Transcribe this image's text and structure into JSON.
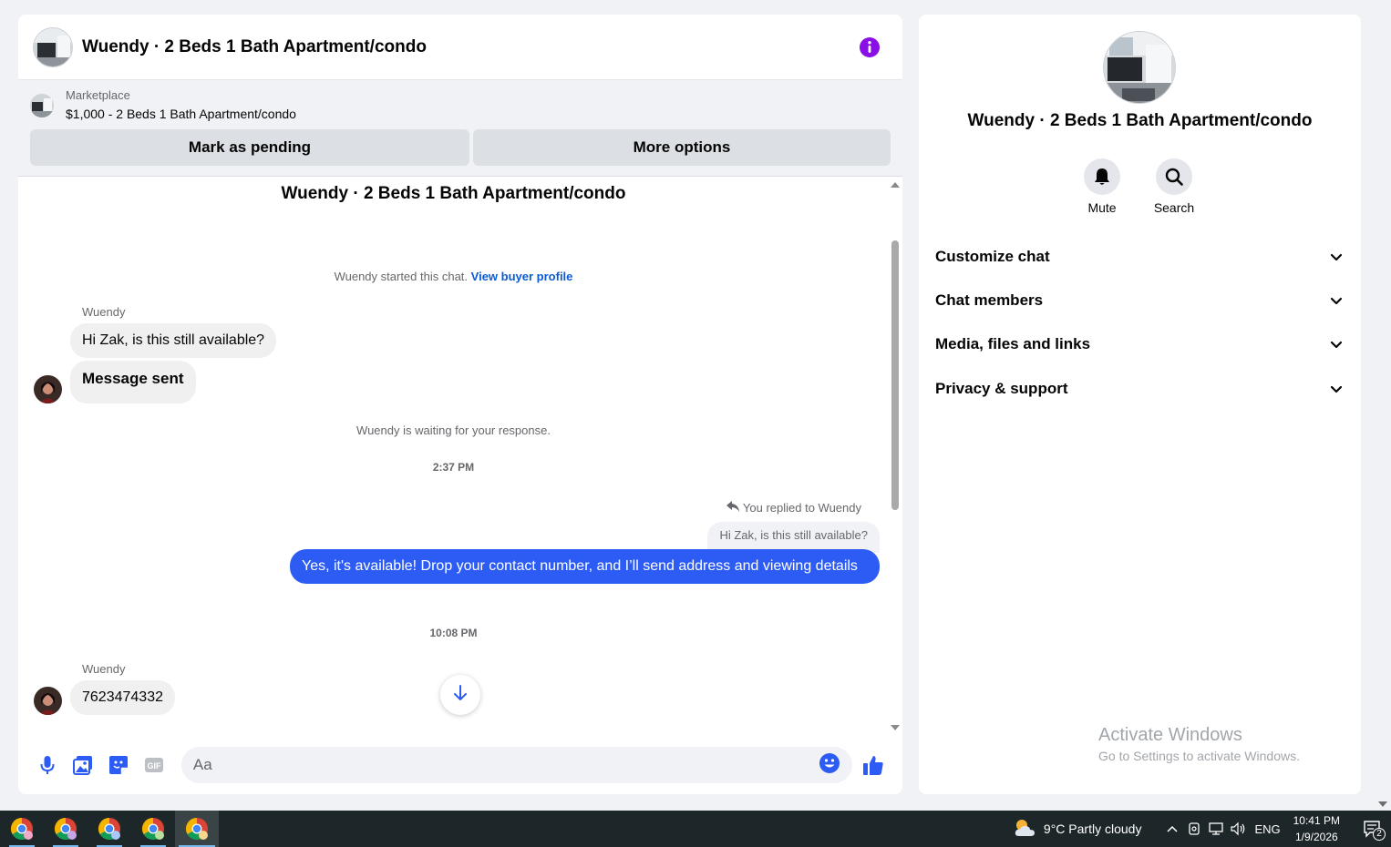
{
  "chat": {
    "title": "Wuendy · 2 Beds 1 Bath Apartment/condo",
    "marketplace_label": "Marketplace",
    "listing": "$1,000 - 2 Beds 1 Bath Apartment/condo",
    "mark_pending_label": "Mark as pending",
    "more_options_label": "More options",
    "conversation_title": "Wuendy · 2 Beds 1 Bath Apartment/condo",
    "started_text": "Wuendy started this chat.",
    "view_buyer_profile": "View buyer profile",
    "sender_1": "Wuendy",
    "msg_1": "Hi Zak, is this still available?",
    "msg_2": "Message sent",
    "waiting_text": "Wuendy is waiting for your response.",
    "time_1": "2:37 PM",
    "reply_note": "You replied to Wuendy",
    "quoted": "Hi Zak, is this still available?",
    "my_reply": "Yes, it's available! Drop your contact number, and I’ll send address and viewing details",
    "time_2": "10:08 PM",
    "sender_2": "Wuendy",
    "msg_3": "7623474332",
    "composer_placeholder": "Aa",
    "accent_color": "#2d5cf5",
    "info_color": "#8a0ee6"
  },
  "info": {
    "name": "Wuendy · 2 Beds 1 Bath Apartment/condo",
    "mute_label": "Mute",
    "search_label": "Search",
    "sections": [
      "Customize chat",
      "Chat members",
      "Media, files and links",
      "Privacy & support"
    ]
  },
  "watermark": {
    "line1": "Activate Windows",
    "line2": "Go to Settings to activate Windows."
  },
  "taskbar": {
    "weather": "9°C  Partly cloudy",
    "lang": "ENG",
    "time": "10:41 PM",
    "date": "1/9/2026",
    "notifications": "2"
  }
}
